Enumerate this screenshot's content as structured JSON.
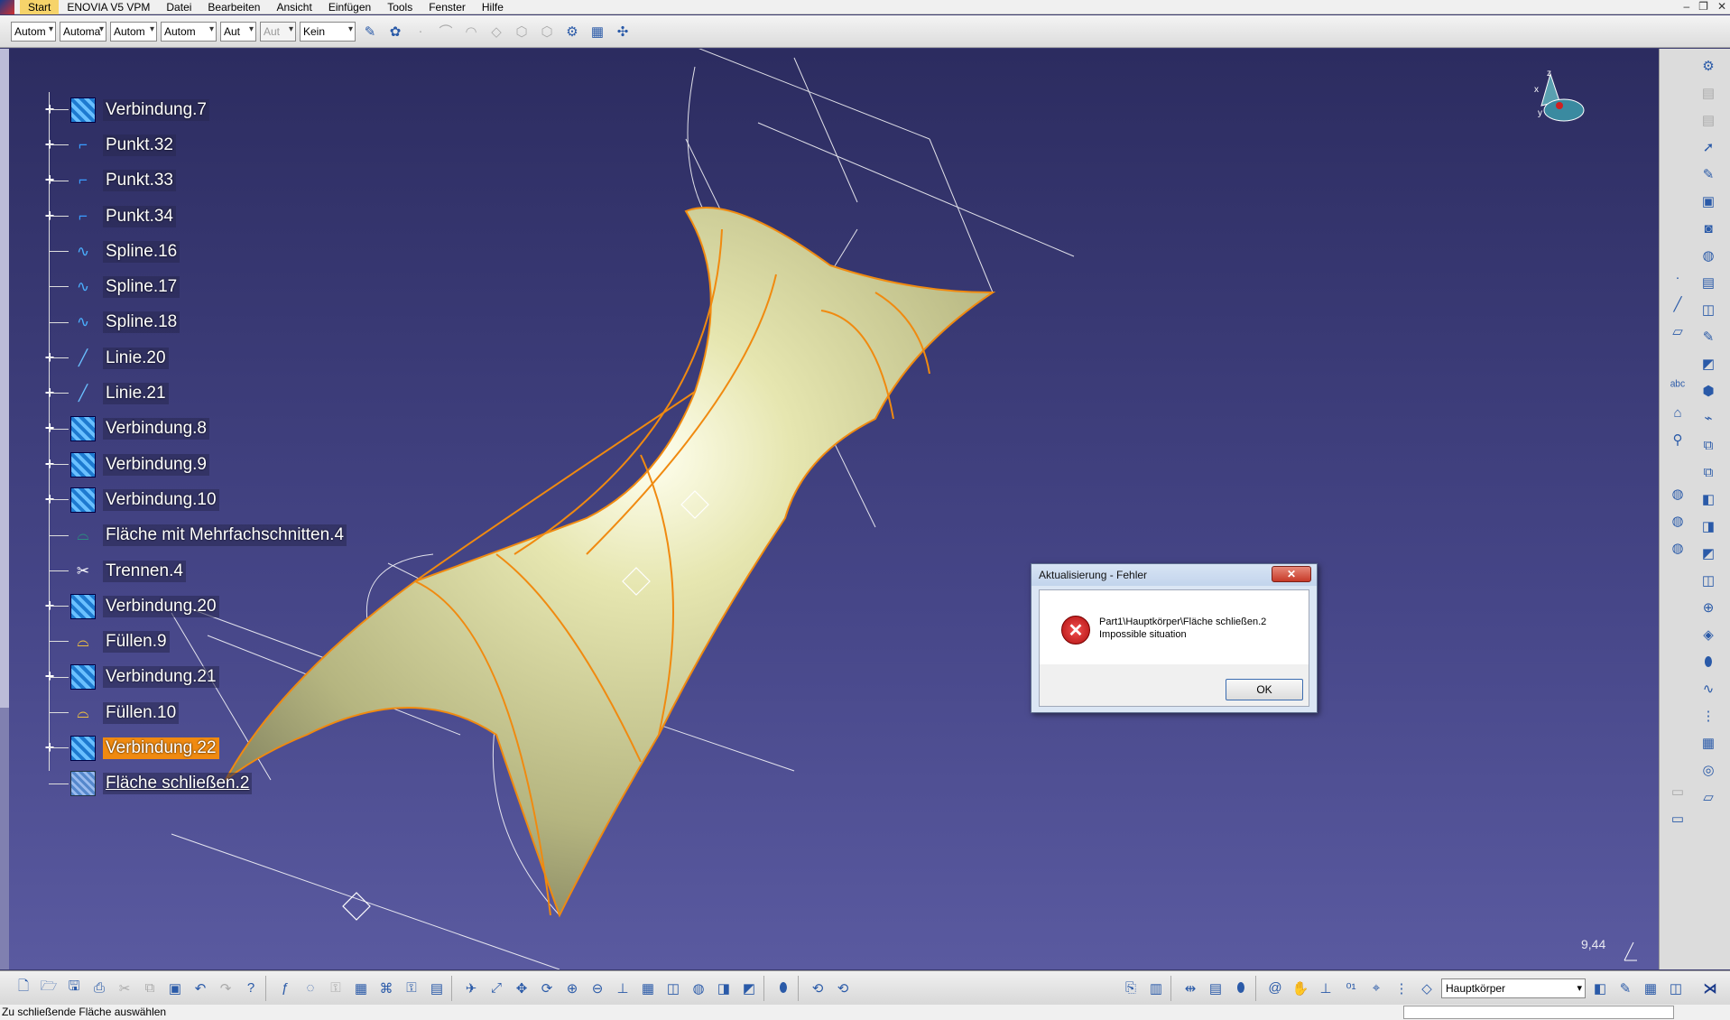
{
  "menu": {
    "items": [
      "Start",
      "ENOVIA V5 VPM",
      "Datei",
      "Bearbeiten",
      "Ansicht",
      "Einfügen",
      "Tools",
      "Fenster",
      "Hilfe"
    ]
  },
  "toolbar": {
    "combos": [
      "Autom",
      "Automa",
      "Autom",
      "Autom",
      "Aut",
      "Aut",
      "Kein"
    ]
  },
  "tree": {
    "nodes": [
      {
        "label": "Verbindung.7",
        "icon": "link-icon",
        "expandable": true
      },
      {
        "label": "Punkt.32",
        "icon": "point-icon",
        "expandable": true
      },
      {
        "label": "Punkt.33",
        "icon": "point-icon",
        "expandable": true
      },
      {
        "label": "Punkt.34",
        "icon": "point-icon",
        "expandable": true
      },
      {
        "label": "Spline.16",
        "icon": "spline-icon",
        "expandable": false
      },
      {
        "label": "Spline.17",
        "icon": "spline-icon",
        "expandable": false
      },
      {
        "label": "Spline.18",
        "icon": "spline-icon",
        "expandable": false
      },
      {
        "label": "Linie.20",
        "icon": "line-icon",
        "expandable": true
      },
      {
        "label": "Linie.21",
        "icon": "line-icon",
        "expandable": true
      },
      {
        "label": "Verbindung.8",
        "icon": "link-icon",
        "expandable": true
      },
      {
        "label": "Verbindung.9",
        "icon": "link-icon",
        "expandable": true
      },
      {
        "label": "Verbindung.10",
        "icon": "link-icon",
        "expandable": true
      },
      {
        "label": "Fläche mit Mehrfachschnitten.4",
        "icon": "loft-icon",
        "expandable": false
      },
      {
        "label": "Trennen.4",
        "icon": "split-icon",
        "expandable": false
      },
      {
        "label": "Verbindung.20",
        "icon": "link-icon",
        "expandable": true
      },
      {
        "label": "Füllen.9",
        "icon": "fill-icon",
        "expandable": false
      },
      {
        "label": "Verbindung.21",
        "icon": "link-icon",
        "expandable": true
      },
      {
        "label": "Füllen.10",
        "icon": "fill-icon",
        "expandable": false
      },
      {
        "label": "Verbindung.22",
        "icon": "link-icon",
        "expandable": true,
        "highlighted": true
      },
      {
        "label": "Fläche schließen.2",
        "icon": "close-surface-icon",
        "expandable": false,
        "underlined": true
      }
    ]
  },
  "dialog": {
    "title": "Aktualisierung - Fehler",
    "close_label": "✕",
    "message_line1": "Part1\\Hauptkörper\\Fläche schließen.2",
    "message_line2": "Impossible situation",
    "ok_label": "OK"
  },
  "viewport": {
    "zoom": "9,44"
  },
  "bottom_toolbar": {
    "body_selector": "Hauptkörper"
  },
  "status": {
    "text": "Zu schließende Fläche auswählen"
  },
  "colors": {
    "background": "#3a3a6e",
    "edge": "#f08a10",
    "surface": "#d8d89a",
    "highlight": "#f08a10"
  }
}
